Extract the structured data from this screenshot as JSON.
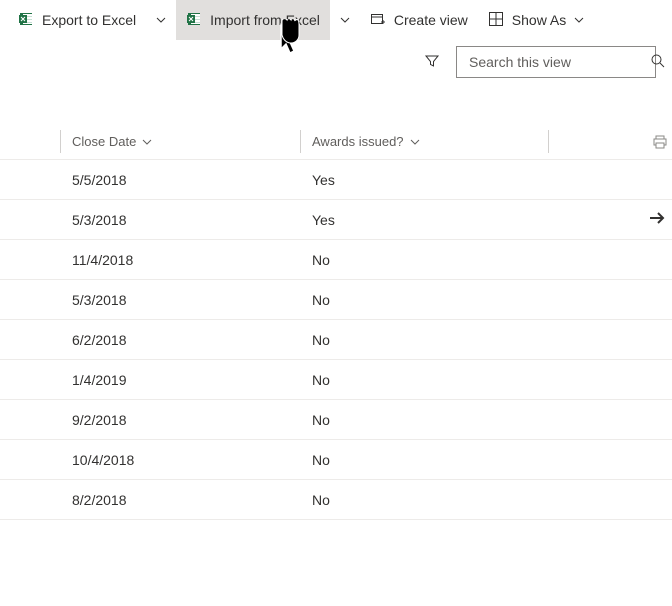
{
  "toolbar": {
    "export_label": "Export to Excel",
    "import_label": "Import from Excel",
    "create_view_label": "Create view",
    "show_as_label": "Show As"
  },
  "search": {
    "placeholder": "Search this view"
  },
  "columns": {
    "close_date": "Close Date",
    "awards": "Awards issued?"
  },
  "rows": [
    {
      "close_date": "5/5/2018",
      "awards": "Yes"
    },
    {
      "close_date": "5/3/2018",
      "awards": "Yes"
    },
    {
      "close_date": "11/4/2018",
      "awards": "No"
    },
    {
      "close_date": "5/3/2018",
      "awards": "No"
    },
    {
      "close_date": "6/2/2018",
      "awards": "No"
    },
    {
      "close_date": "1/4/2019",
      "awards": "No"
    },
    {
      "close_date": "9/2/2018",
      "awards": "No"
    },
    {
      "close_date": "10/4/2018",
      "awards": "No"
    },
    {
      "close_date": "8/2/2018",
      "awards": "No"
    }
  ]
}
